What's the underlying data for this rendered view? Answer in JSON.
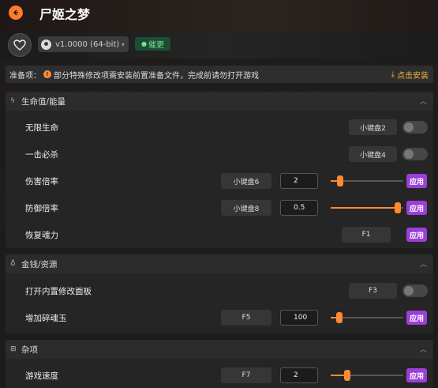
{
  "window": {
    "title": "尸姬之梦"
  },
  "topbar": {
    "version": "v1.0000 (64-bit)",
    "update_badge": "催更"
  },
  "prep": {
    "label": "准备项：",
    "message": "部分特殊修改项需安装前置准备文件，完成前请勿打开游戏",
    "install_link": "点击安装"
  },
  "sections": {
    "health": {
      "title": "生命值/能量",
      "rows": {
        "infinite_health": {
          "label": "无限生命",
          "hotkey": "小键盘2",
          "enabled": false
        },
        "one_hit_kill": {
          "label": "一击必杀",
          "hotkey": "小键盘4",
          "enabled": false
        },
        "damage_multiplier": {
          "label": "伤害倍率",
          "hotkey": "小键盘6",
          "value": "2",
          "slider_fraction": 0.1,
          "apply": "应用"
        },
        "defense_multiplier": {
          "label": "防御倍率",
          "hotkey": "小键盘8",
          "value": "0.5",
          "slider_fraction": 0.96,
          "apply": "应用"
        },
        "restore_soul": {
          "label": "恢复魂力",
          "hotkey": "F1",
          "apply": "应用"
        }
      }
    },
    "money": {
      "title": "金钱/资源",
      "rows": {
        "open_panel": {
          "label": "打开内置修改面板",
          "hotkey": "F3",
          "enabled": false
        },
        "add_soul_jade": {
          "label": "增加碎魂玉",
          "hotkey": "F5",
          "value": "100",
          "slider_fraction": 0.08,
          "apply": "应用"
        }
      }
    },
    "misc": {
      "title": "杂项",
      "rows": {
        "game_speed": {
          "label": "游戏速度",
          "hotkey": "F7",
          "value": "2",
          "slider_fraction": 0.2,
          "apply": "应用"
        }
      }
    }
  },
  "colors": {
    "accent_orange": "#ff8a30",
    "apply_purple": "#9b3fd9",
    "update_green": "#6fe39a",
    "install_gold": "#f0b43c"
  }
}
